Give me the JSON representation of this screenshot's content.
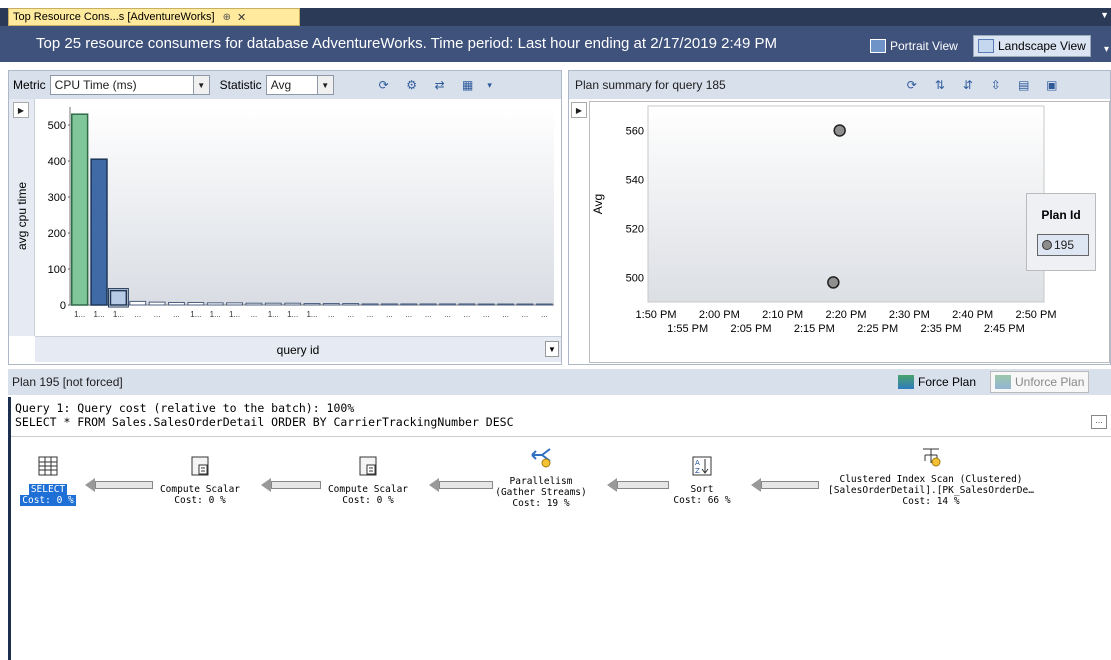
{
  "tab": {
    "title": "Top Resource Cons...s [AdventureWorks]",
    "pin": "⊕",
    "close": "✕"
  },
  "header": {
    "title": "Top 25 resource consumers for database AdventureWorks. Time period: Last hour ending at 2/17/2019 2:49 PM",
    "portrait_label": "Portrait View",
    "landscape_label": "Landscape View"
  },
  "left_toolbar": {
    "metric_label": "Metric",
    "metric_value": "CPU Time (ms)",
    "statistic_label": "Statistic",
    "statistic_value": "Avg"
  },
  "right_toolbar": {
    "title": "Plan summary for query 185"
  },
  "chart_data": [
    {
      "type": "bar",
      "ylabel": "avg cpu time",
      "xlabel": "query id",
      "ylim": [
        0,
        550
      ],
      "yticks": [
        0,
        100,
        200,
        300,
        400,
        500
      ],
      "categories": [
        "1...",
        "1...",
        "1...",
        "...",
        "...",
        "...",
        "1...",
        "1...",
        "1...",
        "...",
        "1...",
        "1...",
        "1...",
        "...",
        "...",
        "...",
        "...",
        "...",
        "...",
        "...",
        "...",
        "...",
        "...",
        "...",
        "..."
      ],
      "values": [
        530,
        405,
        40,
        10,
        8,
        7,
        7,
        6,
        6,
        5,
        5,
        5,
        4,
        4,
        4,
        3,
        3,
        3,
        3,
        3,
        3,
        2,
        2,
        2,
        2
      ],
      "colors": [
        "#3d9b5f",
        "#2a4f86",
        "#4a6fa3"
      ],
      "selected_index": 2
    },
    {
      "type": "scatter",
      "ylabel": "Avg",
      "ylim": [
        490,
        570
      ],
      "yticks": [
        500,
        520,
        540,
        560
      ],
      "xticks_top": [
        "1:50 PM",
        "2:00 PM",
        "2:10 PM",
        "2:20 PM",
        "2:30 PM",
        "2:40 PM",
        "2:50 PM"
      ],
      "xticks_bottom": [
        "1:55 PM",
        "2:05 PM",
        "2:15 PM",
        "2:25 PM",
        "2:35 PM",
        "2:45 PM"
      ],
      "series": [
        {
          "name": "195",
          "points": [
            {
              "x": "2:19 PM",
              "y": 560
            },
            {
              "x": "2:18 PM",
              "y": 498
            }
          ]
        }
      ],
      "legend": {
        "title": "Plan Id",
        "position": "right"
      }
    }
  ],
  "plan_bar": {
    "label": "Plan 195 [not forced]",
    "force_label": "Force Plan",
    "unforce_label": "Unforce Plan"
  },
  "query": {
    "line1": "Query 1: Query cost (relative to the batch): 100%",
    "line2": "SELECT * FROM Sales.SalesOrderDetail ORDER BY CarrierTrackingNumber DESC"
  },
  "plan_nodes": [
    {
      "line1": "SELECT",
      "line2": "Cost: 0 %",
      "icon": "select-icon"
    },
    {
      "line1": "Compute Scalar",
      "line2": "Cost: 0 %",
      "icon": "compute-scalar-icon"
    },
    {
      "line1": "Compute Scalar",
      "line2": "Cost: 0 %",
      "icon": "compute-scalar-icon"
    },
    {
      "line1": "Parallelism",
      "line2": "(Gather Streams)",
      "line3": "Cost: 19 %",
      "icon": "parallelism-icon"
    },
    {
      "line1": "Sort",
      "line2": "Cost: 66 %",
      "icon": "sort-icon"
    },
    {
      "line1": "Clustered Index Scan (Clustered)",
      "line2": "[SalesOrderDetail].[PK_SalesOrderDe…",
      "line3": "Cost: 14 %",
      "icon": "clustered-index-scan-icon"
    }
  ]
}
